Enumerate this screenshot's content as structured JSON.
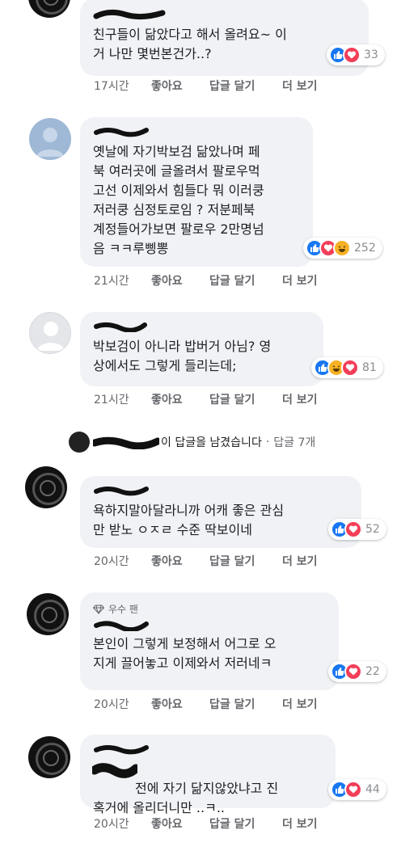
{
  "comments": [
    {
      "text": "친구들이 닮았다고 해서 올려요~ 이\n거 나만 몇번본건가..?",
      "reaction_count": "33",
      "time": "17시간",
      "like_label": "좋아요",
      "reply_label": "답글 달기",
      "more_label": "더 보기"
    },
    {
      "text": "옛날에 자기박보검 닮았나며 페\n북 여러곳에 글올려서 팔로우먹\n고선 이제와서 힘들다 뭐 이러쿵\n저러쿵 심정토로임 ? 저분페북\n계정들어가보면 팔로우 2만명넘\n음 ㅋㅋ루삥뽕",
      "reaction_count": "252",
      "time": "21시간",
      "like_label": "좋아요",
      "reply_label": "답글 달기",
      "more_label": "더 보기"
    },
    {
      "text": "박보검이 아니라 밥버거 아님? 영\n상에서도 그렇게 들리는데;",
      "reaction_count": "81",
      "time": "21시간",
      "like_label": "좋아요",
      "reply_label": "답글 달기",
      "more_label": "더 보기"
    },
    {
      "text": "욕하지말아달라니까 어캐 좋은 관심\n만 받노 ㅇㅈㄹ 수준 딱보이네",
      "reaction_count": "52",
      "time": "20시간",
      "like_label": "좋아요",
      "reply_label": "답글 달기",
      "more_label": "더 보기"
    },
    {
      "badge": "우수 팬",
      "text": "본인이 그렇게 보정해서 어그로 오\n지게 끌어놓고 이제와서 저러네ㅋ",
      "reaction_count": "22",
      "time": "20시간",
      "like_label": "좋아요",
      "reply_label": "답글 달기",
      "more_label": "더 보기"
    },
    {
      "text": "전에 자기 닮지않았냐고 진\n혹거에 올리더니만 ..ㅋ..",
      "reaction_count": "44",
      "time": "20시간",
      "like_label": "좋아요",
      "reply_label": "답글 달기",
      "more_label": "더 보기"
    }
  ],
  "replies_summary": {
    "text": "이 답글을 남겼습니다",
    "separator": "·",
    "count": "답글 7개"
  },
  "colors": {
    "like_blue": "#1877f2",
    "love_red": "#f33e58",
    "haha_yellow": "#f7b125",
    "bubble_bg": "#f0f2f5",
    "meta_grey": "#65676b"
  },
  "icons": [
    "like-icon",
    "love-icon",
    "haha-icon",
    "diamond-icon"
  ]
}
